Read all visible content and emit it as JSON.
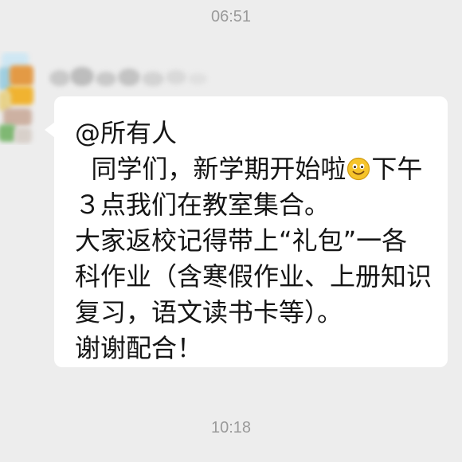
{
  "timestamps": {
    "top": "06:51",
    "bottom": "10:18"
  },
  "message": {
    "mention": "@所有人",
    "line_1": "  同学们，新学期开始啦",
    "emoji": "smiley-face-icon",
    "line_2": "下午３点我们在教室集合。",
    "line_3": "大家返校记得带上“礼包”一各科作业（含寒假作业、上册知识复习，语文读书卡等）。",
    "line_4": "谢谢配合！"
  },
  "colors": {
    "chat_background": "#ededed",
    "bubble_background": "#ffffff",
    "timestamp_text": "#9a9a9a",
    "message_text": "#151515",
    "emoji_face": "#f6c42a"
  }
}
